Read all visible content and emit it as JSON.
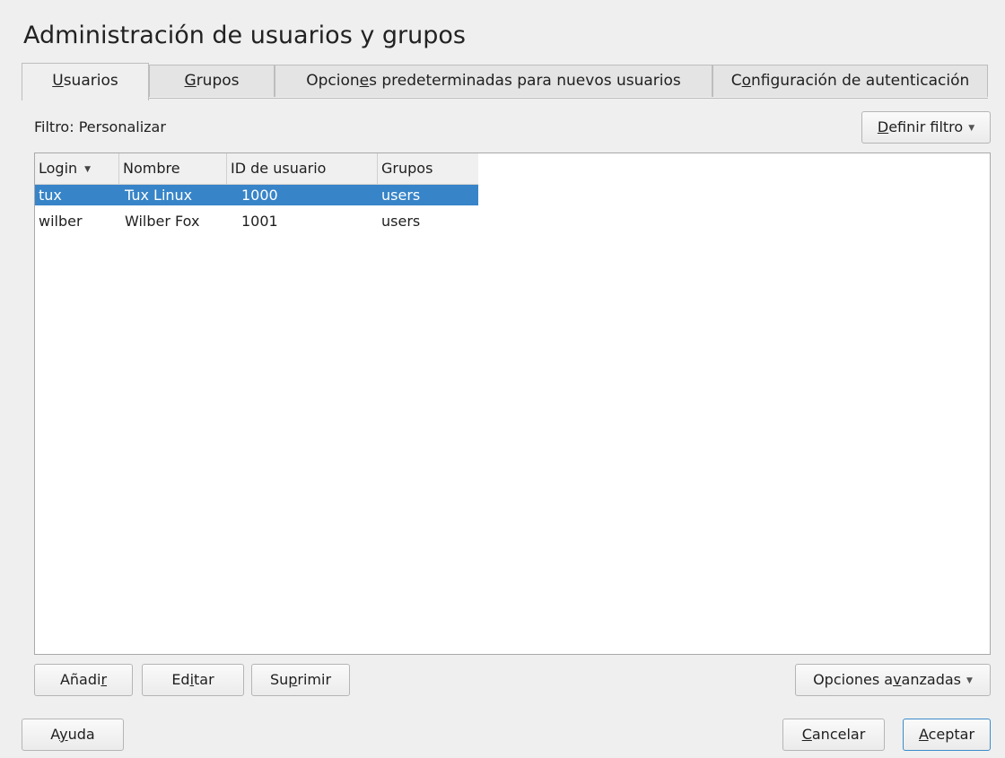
{
  "window": {
    "title": "Administración de usuarios y grupos"
  },
  "tabs": [
    {
      "label_before": "",
      "label_mnemonic": "U",
      "label_after": "suarios"
    },
    {
      "label_before": "",
      "label_mnemonic": "G",
      "label_after": "rupos"
    },
    {
      "label_before": "Opcion",
      "label_mnemonic": "e",
      "label_after": "s predeterminadas para nuevos usuarios"
    },
    {
      "label_before": "C",
      "label_mnemonic": "o",
      "label_after": "nfiguración de autenticación"
    }
  ],
  "filter": {
    "label": "Filtro: Personalizar",
    "button_before": "",
    "button_mnemonic": "D",
    "button_after": "efinir filtro"
  },
  "table": {
    "columns": [
      "Login",
      "Nombre",
      "ID de usuario",
      "Grupos"
    ],
    "sort_column": "Login",
    "rows": [
      {
        "login": "tux",
        "nombre": "Tux Linux",
        "id": "1000",
        "grupos": "users",
        "selected": true
      },
      {
        "login": "wilber",
        "nombre": "Wilber Fox",
        "id": "1001",
        "grupos": "users",
        "selected": false
      }
    ]
  },
  "actions": {
    "add_before": "Añadi",
    "add_mnemonic": "r",
    "add_after": "",
    "edit_before": "Ed",
    "edit_mnemonic": "i",
    "edit_after": "tar",
    "delete_before": "Su",
    "delete_mnemonic": "p",
    "delete_after": "rimir",
    "advanced_before": "Opciones a",
    "advanced_mnemonic": "v",
    "advanced_after": "anzadas"
  },
  "footer": {
    "help_before": "A",
    "help_mnemonic": "y",
    "help_after": "uda",
    "cancel_before": "",
    "cancel_mnemonic": "C",
    "cancel_after": "ancelar",
    "accept_before": "",
    "accept_mnemonic": "A",
    "accept_after": "ceptar"
  },
  "colors": {
    "selection": "#3784c8",
    "primary_border": "#3b8bc9",
    "background": "#efefef"
  }
}
